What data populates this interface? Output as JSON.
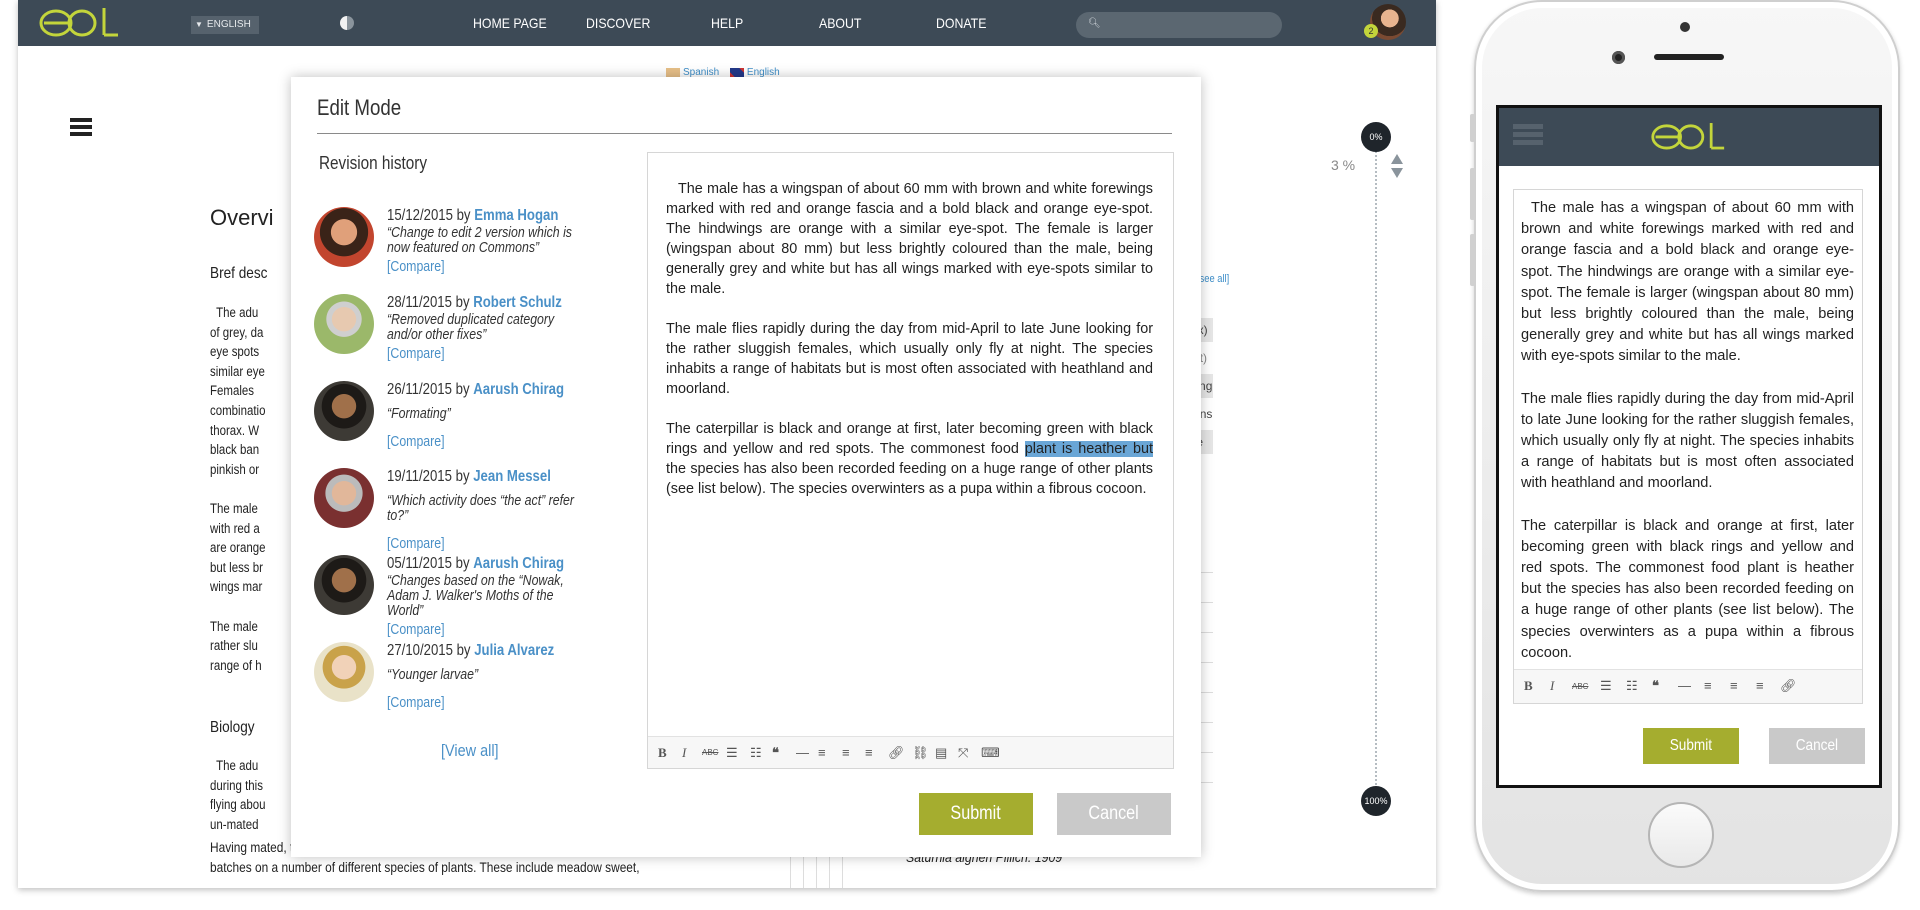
{
  "desktop": {
    "header": {
      "logo": "eol",
      "language": "ENGLISH",
      "nav": [
        "HOME PAGE",
        "DISCOVER",
        "HELP",
        "ABOUT",
        "DONATE"
      ],
      "search_placeholder": "",
      "notification_count": "2"
    },
    "background": {
      "languages": [
        "Spanish",
        "English"
      ],
      "overview": "Overvi",
      "bref": "Bref desc",
      "paragraph": "  The adu\nof grey, da\neye spots\nsimilar eye\nFemales \ncombinatio\nthorax. W\nblack ban\npinkish or \n\nThe male \nwith red a\nare orange\nbut less br\nwings mar\n\nThe male \nrather slu\nrange of h",
      "biology": "Biology",
      "bio_paragraph": "  The adu\nduring this\nflying abou\nun-mated",
      "mated_line": "Having mated, the females fly off in the early part of the night to lay their eggs in\nbatches on a number of different species of plants. These include meadow sweet,",
      "see_all": "[see all]",
      "chips": [
        "(max)",
        "adult)",
        "easing",
        "egions",
        "June"
      ],
      "saturnia": "Saturnia aigneri Pillich. 1909"
    },
    "progress": {
      "top_label": "0%",
      "bottom_label": "100%",
      "percent": "3 %",
      "level": 3
    },
    "modal": {
      "title": "Edit Mode",
      "revision_title": "Revision history",
      "revisions": [
        {
          "date": "15/12/2015",
          "by": "by",
          "author": "Emma Hogan",
          "message": "“Change to edit 2 version which is now featured on Commons”",
          "compare": "[Compare]"
        },
        {
          "date": "28/11/2015",
          "by": "by",
          "author": "Robert Schulz",
          "message": "“Removed duplicated category and/or other fixes”",
          "compare": "[Compare]"
        },
        {
          "date": "26/11/2015",
          "by": "by",
          "author": "Aarush Chirag",
          "message": "“Formating”",
          "compare": "[Compare]"
        },
        {
          "date": "19/11/2015",
          "by": "by",
          "author": "Jean Messel",
          "message": "“Which activity does “the act” refer to?”",
          "compare": "[Compare]"
        },
        {
          "date": "05/11/2015",
          "by": "by",
          "author": "Aarush Chirag",
          "message": "“Changes based on the “Nowak, Adam J. Walker's Moths of the World”",
          "compare": "[Compare]"
        },
        {
          "date": "27/10/2015",
          "by": "by",
          "author": "Julia Alvarez",
          "message": "“Younger larvae”",
          "compare": "[Compare]"
        }
      ],
      "view_all": "[View all]",
      "editor": {
        "p1": "The male has a wingspan of about 60 mm with brown and white forewings marked with red and orange fascia and a bold black and orange eye-spot. The hindwings are orange with a similar eye-spot. The female is larger (wingspan about 80 mm) but less brightly coloured than the male, being generally grey and white but has all wings marked with eye-spots similar to the male.",
        "p2": "The male flies rapidly during the day from mid-April to late June looking for the rather sluggish females, which usually only fly at night. The species inhabits a range of habitats but is most often associated with heathland and moorland.",
        "p3_before": "The caterpillar is black and orange at first, later becoming green with black rings and yellow and red spots. The commonest food ",
        "p3_highlight": "plant is heather but",
        "p3_after": " the species has also been recorded feeding on a huge range of other plants (see list below). The species overwinters as a pupa within a fibrous cocoon."
      },
      "submit": "Submit",
      "cancel": "Cancel"
    }
  },
  "phone": {
    "logo": "eol",
    "editor": {
      "p1": "The male has a wingspan of about 60 mm with brown and white forewings marked with red and orange fascia and a bold black and orange eye-spot. The hindwings are orange with a similar eye-spot. The female is larger (wingspan about 80 mm) but less brightly coloured than the male, being generally grey and white but has all wings marked with eye-spots similar to the male.",
      "p2": "The male flies rapidly during the day from mid-April to late June looking for the rather sluggish females, which usually only fly at night. The species inhabits a range of habitats but is most often associated with heathland and moorland.",
      "p3": "The caterpillar is black and orange at first, later becoming green with black rings and yellow and red spots. The commonest food plant is heather but the species has also been recorded feeding on a huge range of other plants (see list below). The species overwinters as a pupa within a fibrous cocoon."
    },
    "submit": "Submit",
    "cancel": "Cancel"
  },
  "toolbar_icons": [
    "bold-icon",
    "italic-icon",
    "strikethrough-icon",
    "bullet-list-icon",
    "numbered-list-icon",
    "quote-icon",
    "horizontal-rule-icon",
    "align-left-icon",
    "align-center-icon",
    "align-right-icon",
    "link-icon",
    "unlink-icon",
    "table-icon",
    "fullscreen-icon",
    "keyboard-icon"
  ],
  "colors": {
    "header": "#3d4a56",
    "accent": "#c3d53b",
    "link": "#4a90c7",
    "submit": "#a5ad2f",
    "cancel": "#c9c9c9",
    "highlight": "#6aa6d6"
  }
}
